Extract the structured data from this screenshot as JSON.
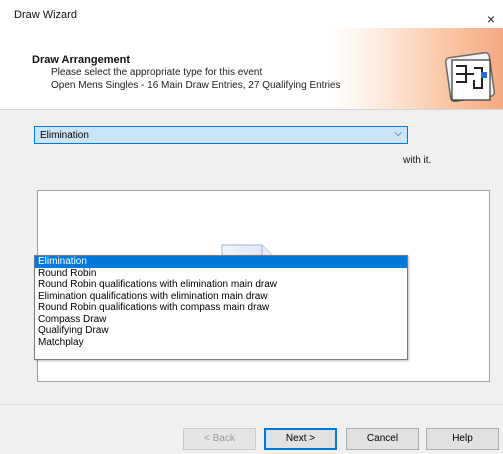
{
  "window": {
    "title": "Draw Wizard",
    "close_glyph": "×"
  },
  "header": {
    "title": "Draw Arrangement",
    "description": "Please select the appropriate type for this event",
    "event_info": "Open Mens Singles - 16 Main Draw Entries, 27 Qualifying Entries"
  },
  "draw_type": {
    "selected": "Elimination",
    "arrow": "⌵",
    "options": [
      "Elimination",
      "Round Robin",
      "Round Robin qualifications with elimination main draw",
      "Elimination qualifications with elimination main draw",
      "Round Robin qualifications with compass main draw",
      "Compass Draw",
      "Qualifying Draw",
      "Matchplay"
    ]
  },
  "background_text": "with it.",
  "buttons": {
    "back": "< Back",
    "next": "Next >",
    "cancel": "Cancel",
    "help": "Help"
  },
  "colors": {
    "accent": "#0078d7",
    "header_gradient_end": "#f6a983"
  }
}
